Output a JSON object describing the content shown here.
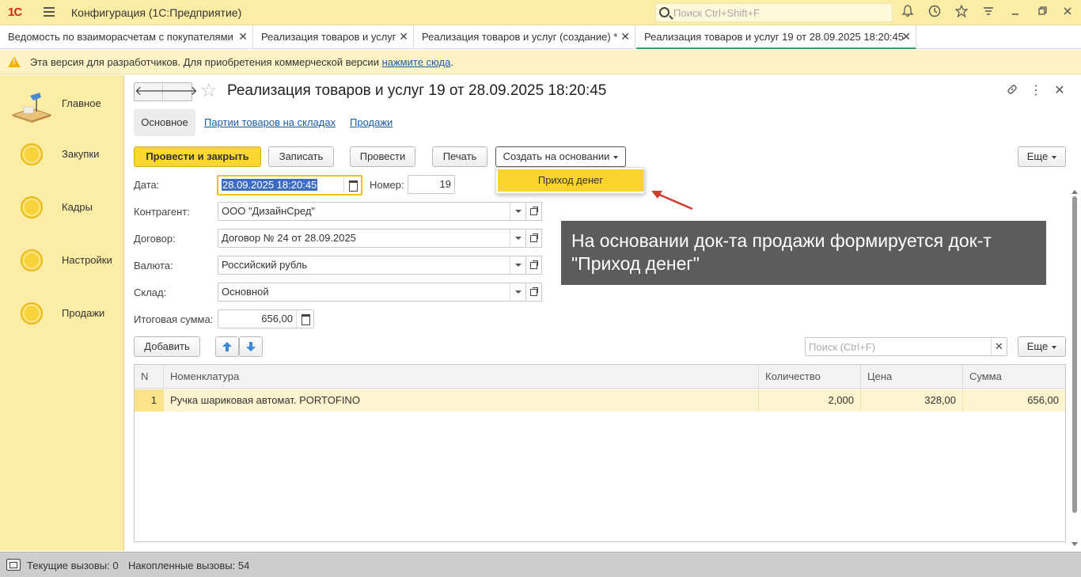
{
  "app": {
    "logo": "1С",
    "title": "Конфигурация  (1С:Предприятие)",
    "search_placeholder": "Поиск Ctrl+Shift+F"
  },
  "tabs": [
    {
      "label": "Ведомость по взаиморасчетам с покупателями"
    },
    {
      "label": "Реализация товаров и услуг"
    },
    {
      "label": "Реализация товаров и услуг (создание) *"
    },
    {
      "label": "Реализация товаров и услуг 19 от 28.09.2025 18:20:45",
      "active": true
    }
  ],
  "dev_notice": {
    "text": "Эта версия для разработчиков. Для приобретения коммерческой версии ",
    "link": "нажмите сюда",
    "suffix": "."
  },
  "sidebar": {
    "items": [
      {
        "label": "Главное",
        "icon": "home-desk-icon"
      },
      {
        "label": "Закупки",
        "icon": "circle-icon"
      },
      {
        "label": "Кадры",
        "icon": "circle-icon"
      },
      {
        "label": "Настройки",
        "icon": "circle-icon"
      },
      {
        "label": "Продажи",
        "icon": "circle-icon"
      }
    ]
  },
  "form": {
    "title": "Реализация товаров и услуг 19 от 28.09.2025 18:20:45",
    "sections": [
      "Основное",
      "Партии товаров на складах",
      "Продажи"
    ],
    "buttons": {
      "post_close": "Провести и закрыть",
      "save": "Записать",
      "post": "Провести",
      "print": "Печать",
      "create_based": "Создать на основании",
      "more": "Еще"
    },
    "dropdown_item": "Приход денег",
    "fields": {
      "date_label": "Дата:",
      "date_value": "28.09.2025 18:20:45",
      "number_label": "Номер:",
      "number_value": "19",
      "counterparty_label": "Контрагент:",
      "counterparty_value": "ООО \"ДизайнСред\"",
      "contract_label": "Договор:",
      "contract_value": "Договор № 24 от 28.09.2025",
      "currency_label": "Валюта:",
      "currency_value": "Российский рубль",
      "warehouse_label": "Склад:",
      "warehouse_value": "Основной",
      "total_label": "Итоговая сумма:",
      "total_value": "656,00"
    },
    "table_toolbar": {
      "add": "Добавить",
      "search_placeholder": "Поиск (Ctrl+F)",
      "more": "Еще"
    },
    "table": {
      "columns": [
        "N",
        "Номенклатура",
        "Количество",
        "Цена",
        "Сумма"
      ],
      "rows": [
        {
          "n": "1",
          "item": "Ручка шариковая автомат. PORTOFINO",
          "qty": "2,000",
          "price": "328,00",
          "sum": "656,00"
        }
      ]
    }
  },
  "callout": {
    "text": "На основании док-та продажи формируется док-т \"Приход денег\""
  },
  "status": {
    "current_calls": "Текущие вызовы: 0",
    "accumulated_calls": "Накопленные вызовы: 54"
  },
  "colors": {
    "accent_yellow": "#fbd72f",
    "sidebar_bg": "#fbeda6",
    "link_blue": "#1a5fa8",
    "callout_bg": "#5c5c5c",
    "arrow_red": "#d03a2f"
  }
}
